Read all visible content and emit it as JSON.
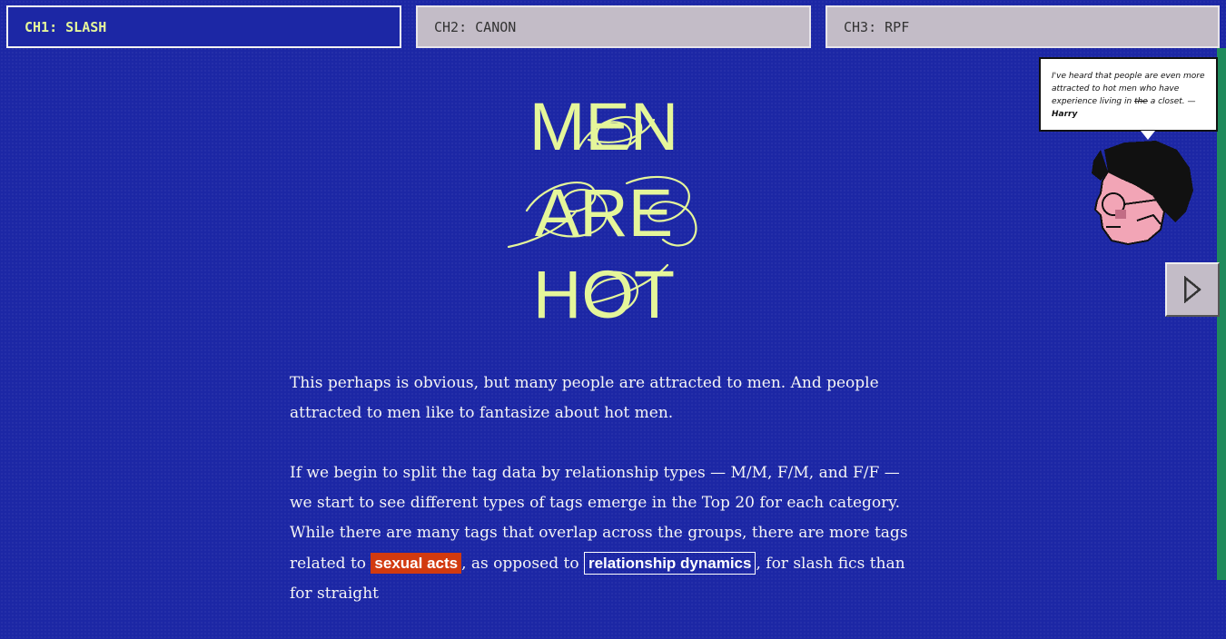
{
  "tabs": [
    {
      "label": "CH1: SLASH"
    },
    {
      "label": "CH2: CANON"
    },
    {
      "label": "CH3: RPF"
    }
  ],
  "title": {
    "line1": "MEN",
    "line2": "ARE",
    "line3": "HOT",
    "color": "#e5f69a"
  },
  "bubble": {
    "text_before": "I've heard that people are even more attracted to hot men who have experience living in ",
    "struck": "the",
    "text_after": " a closet. —",
    "speaker": "Harry"
  },
  "next_button": {
    "icon": "chevron-right-icon"
  },
  "prose": {
    "p1": "This perhaps is obvious, but many people are attracted to men. And people attracted to men like to fantasize about hot men.",
    "p2_before": "If we begin to split the tag data by relationship types — M/M, F/M, and F/F — we start to see different types of tags emerge in the Top 20 for each category. While there are many tags that overlap across the groups, there are more tags related to ",
    "tag_sexual_acts": "sexual acts",
    "p2_middle": ", as opposed to ",
    "tag_relationship_dynamics": "relationship dynamics",
    "p2_after": ", for slash fics than for straight"
  },
  "colors": {
    "background": "#1c27a5",
    "accent": "#e5f69a",
    "tab_inactive": "#c3bcc7",
    "tag_acts": "#d23a0f",
    "edge": "#1f8a5c"
  }
}
